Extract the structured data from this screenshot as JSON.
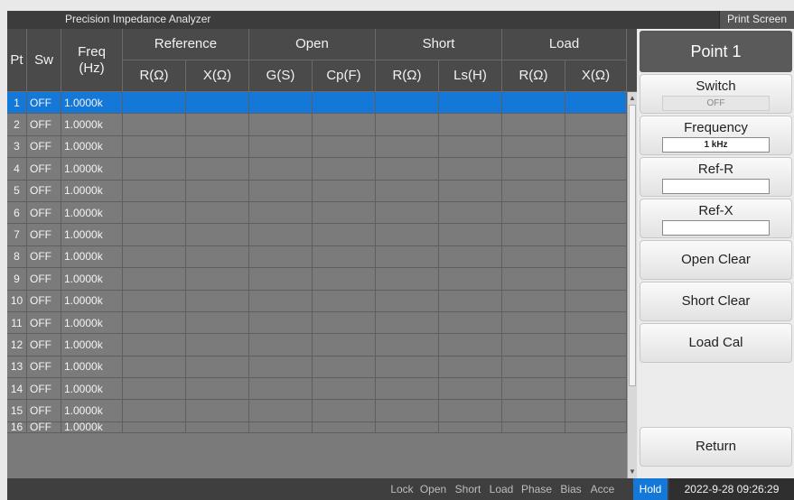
{
  "window": {
    "title": "Precision Impedance Analyzer",
    "print_label": "Print Screen"
  },
  "table": {
    "headers": {
      "pt": "Pt",
      "sw": "Sw",
      "freq": "Freq\n(Hz)",
      "groups": [
        "Reference",
        "Open",
        "Short",
        "Load"
      ],
      "subs": [
        "R(Ω)",
        "X(Ω)",
        "G(S)",
        "Cp(F)",
        "R(Ω)",
        "Ls(H)",
        "R(Ω)",
        "X(Ω)"
      ]
    },
    "rows": [
      {
        "pt": "1",
        "sw": "OFF",
        "freq": "1.0000k",
        "selected": true
      },
      {
        "pt": "2",
        "sw": "OFF",
        "freq": "1.0000k"
      },
      {
        "pt": "3",
        "sw": "OFF",
        "freq": "1.0000k"
      },
      {
        "pt": "4",
        "sw": "OFF",
        "freq": "1.0000k"
      },
      {
        "pt": "5",
        "sw": "OFF",
        "freq": "1.0000k"
      },
      {
        "pt": "6",
        "sw": "OFF",
        "freq": "1.0000k"
      },
      {
        "pt": "7",
        "sw": "OFF",
        "freq": "1.0000k"
      },
      {
        "pt": "8",
        "sw": "OFF",
        "freq": "1.0000k"
      },
      {
        "pt": "9",
        "sw": "OFF",
        "freq": "1.0000k"
      },
      {
        "pt": "10",
        "sw": "OFF",
        "freq": "1.0000k"
      },
      {
        "pt": "11",
        "sw": "OFF",
        "freq": "1.0000k"
      },
      {
        "pt": "12",
        "sw": "OFF",
        "freq": "1.0000k"
      },
      {
        "pt": "13",
        "sw": "OFF",
        "freq": "1.0000k"
      },
      {
        "pt": "14",
        "sw": "OFF",
        "freq": "1.0000k"
      },
      {
        "pt": "15",
        "sw": "OFF",
        "freq": "1.0000k"
      },
      {
        "pt": "16",
        "sw": "OFF",
        "freq": "1.0000k",
        "partial": true
      }
    ]
  },
  "side": {
    "title": "Point 1",
    "switch": {
      "label": "Switch",
      "value": "OFF"
    },
    "frequency": {
      "label": "Frequency",
      "value": "1 kHz"
    },
    "ref_r": {
      "label": "Ref-R",
      "value": ""
    },
    "ref_x": {
      "label": "Ref-X",
      "value": ""
    },
    "open_clear": "Open Clear",
    "short_clear": "Short Clear",
    "load_cal": "Load Cal",
    "return": "Return"
  },
  "status": {
    "items": [
      "Lock",
      "Open",
      "Short",
      "Load",
      "Phase",
      "Bias",
      "Acce"
    ],
    "hold": "Hold",
    "datetime": "2022-9-28 09:26:29"
  },
  "colors": {
    "selection": "#1478d8",
    "header": "#4a4a4a",
    "grid": "#7b7b7b"
  }
}
